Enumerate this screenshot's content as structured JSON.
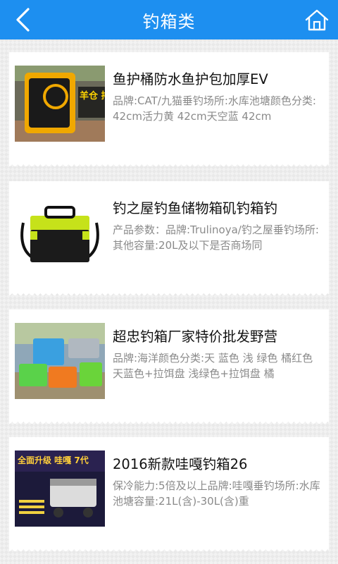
{
  "header": {
    "title": "钓箱类",
    "back_icon": "chevron-left-icon",
    "home_icon": "home-icon",
    "color": "#1d8ff0"
  },
  "items": [
    {
      "title": "鱼护桶防水鱼护包加厚EV",
      "desc": "品牌:CAT/九猫垂钓场所:水库池塘颜色分类:42cm活力黄 42cm天空蓝 42cm",
      "image_text": "羊仓 排水口"
    },
    {
      "title": "钓之屋钓鱼储物箱矶钓箱钓",
      "desc": "产品参数：品牌:Trulinoya/钓之屋垂钓场所:其他容量:20L及以下是否商场同"
    },
    {
      "title": "超忠钓箱厂家特价批发野营",
      "desc": "品牌:海洋颜色分类:天 蓝色 浅 绿色 橘红色 天蓝色+拉饵盘 浅绿色+拉饵盘 橘"
    },
    {
      "title": "2016新款哇嘎钓箱26",
      "desc": "保冷能力:5倍及以上品牌:哇嘎垂钓场所:水库池塘容量:21L(含)-30L(含)重",
      "image_text": "全面升级 哇嘎 7代"
    }
  ]
}
